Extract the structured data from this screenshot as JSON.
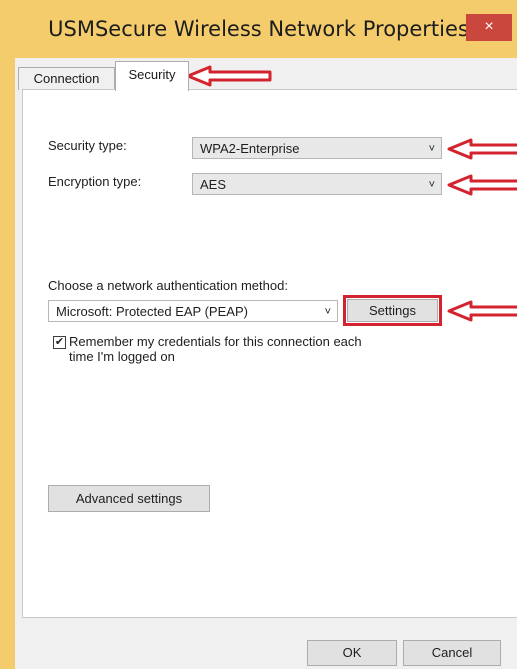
{
  "window": {
    "title": "USMSecure Wireless Network Properties",
    "close_label": "×"
  },
  "tabs": [
    {
      "label": "Connection",
      "active": false
    },
    {
      "label": "Security",
      "active": true
    }
  ],
  "security": {
    "security_type_label": "Security type:",
    "security_type_value": "WPA2-Enterprise",
    "encryption_type_label": "Encryption type:",
    "encryption_type_value": "AES",
    "auth_method_label": "Choose a network authentication method:",
    "auth_method_value": "Microsoft: Protected EAP (PEAP)",
    "settings_button": "Settings",
    "remember_line1": "Remember my credentials for this connection each",
    "remember_line2": "time I'm logged on",
    "remember_checked": true,
    "checkmark": "✔",
    "advanced_button": "Advanced settings"
  },
  "icons": {
    "chevron": "˅"
  },
  "footer": {
    "ok_label": "OK",
    "cancel_label": "Cancel"
  },
  "colors": {
    "title_bar": "#f4cc6c",
    "close_button": "#c9473c",
    "annotation_red": "#d3232f"
  }
}
